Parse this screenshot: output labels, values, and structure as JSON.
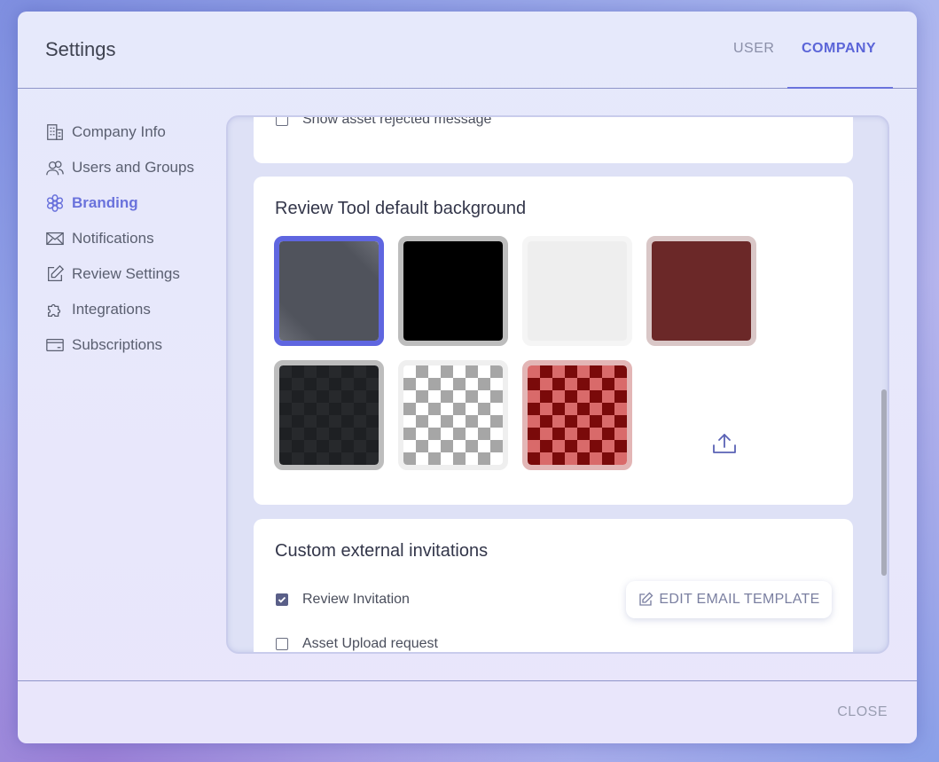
{
  "dialog": {
    "title": "Settings",
    "tabs": [
      {
        "label": "USER",
        "active": false
      },
      {
        "label": "COMPANY",
        "active": true
      }
    ],
    "close_label": "CLOSE"
  },
  "sidebar": {
    "items": [
      {
        "label": "Company Info",
        "icon": "building-icon",
        "active": false
      },
      {
        "label": "Users and Groups",
        "icon": "users-icon",
        "active": false
      },
      {
        "label": "Branding",
        "icon": "flower-icon",
        "active": true
      },
      {
        "label": "Notifications",
        "icon": "envelope-icon",
        "active": false
      },
      {
        "label": "Review Settings",
        "icon": "edit-icon",
        "active": false
      },
      {
        "label": "Integrations",
        "icon": "puzzle-icon",
        "active": false
      },
      {
        "label": "Subscriptions",
        "icon": "card-icon",
        "active": false
      }
    ]
  },
  "asset_messages": {
    "rejected_label": "Show asset rejected message",
    "rejected_checked": false
  },
  "review_background": {
    "title": "Review Tool default background",
    "swatches": [
      {
        "name": "dark-gray",
        "color": "#4f525b",
        "selected": true
      },
      {
        "name": "black",
        "color": "#000000",
        "selected": false
      },
      {
        "name": "light-gray",
        "color": "#eeeeee",
        "selected": false
      },
      {
        "name": "dark-red",
        "color": "#6b2828",
        "selected": false
      },
      {
        "name": "dark-checker",
        "color": "#27292c",
        "selected": false
      },
      {
        "name": "gray-checker",
        "color": "#a6a6a6",
        "selected": false
      },
      {
        "name": "red-checker",
        "color": "#8a0f0f",
        "selected": false
      }
    ],
    "upload_icon": "upload-icon"
  },
  "invitations": {
    "title": "Custom external invitations",
    "review_invitation_label": "Review Invitation",
    "review_invitation_checked": true,
    "edit_template_label": "EDIT EMAIL TEMPLATE",
    "asset_upload_label": "Asset Upload request",
    "asset_upload_checked": false
  },
  "colors": {
    "accent": "#5b65d8",
    "selected_border": "#5f66e0"
  }
}
